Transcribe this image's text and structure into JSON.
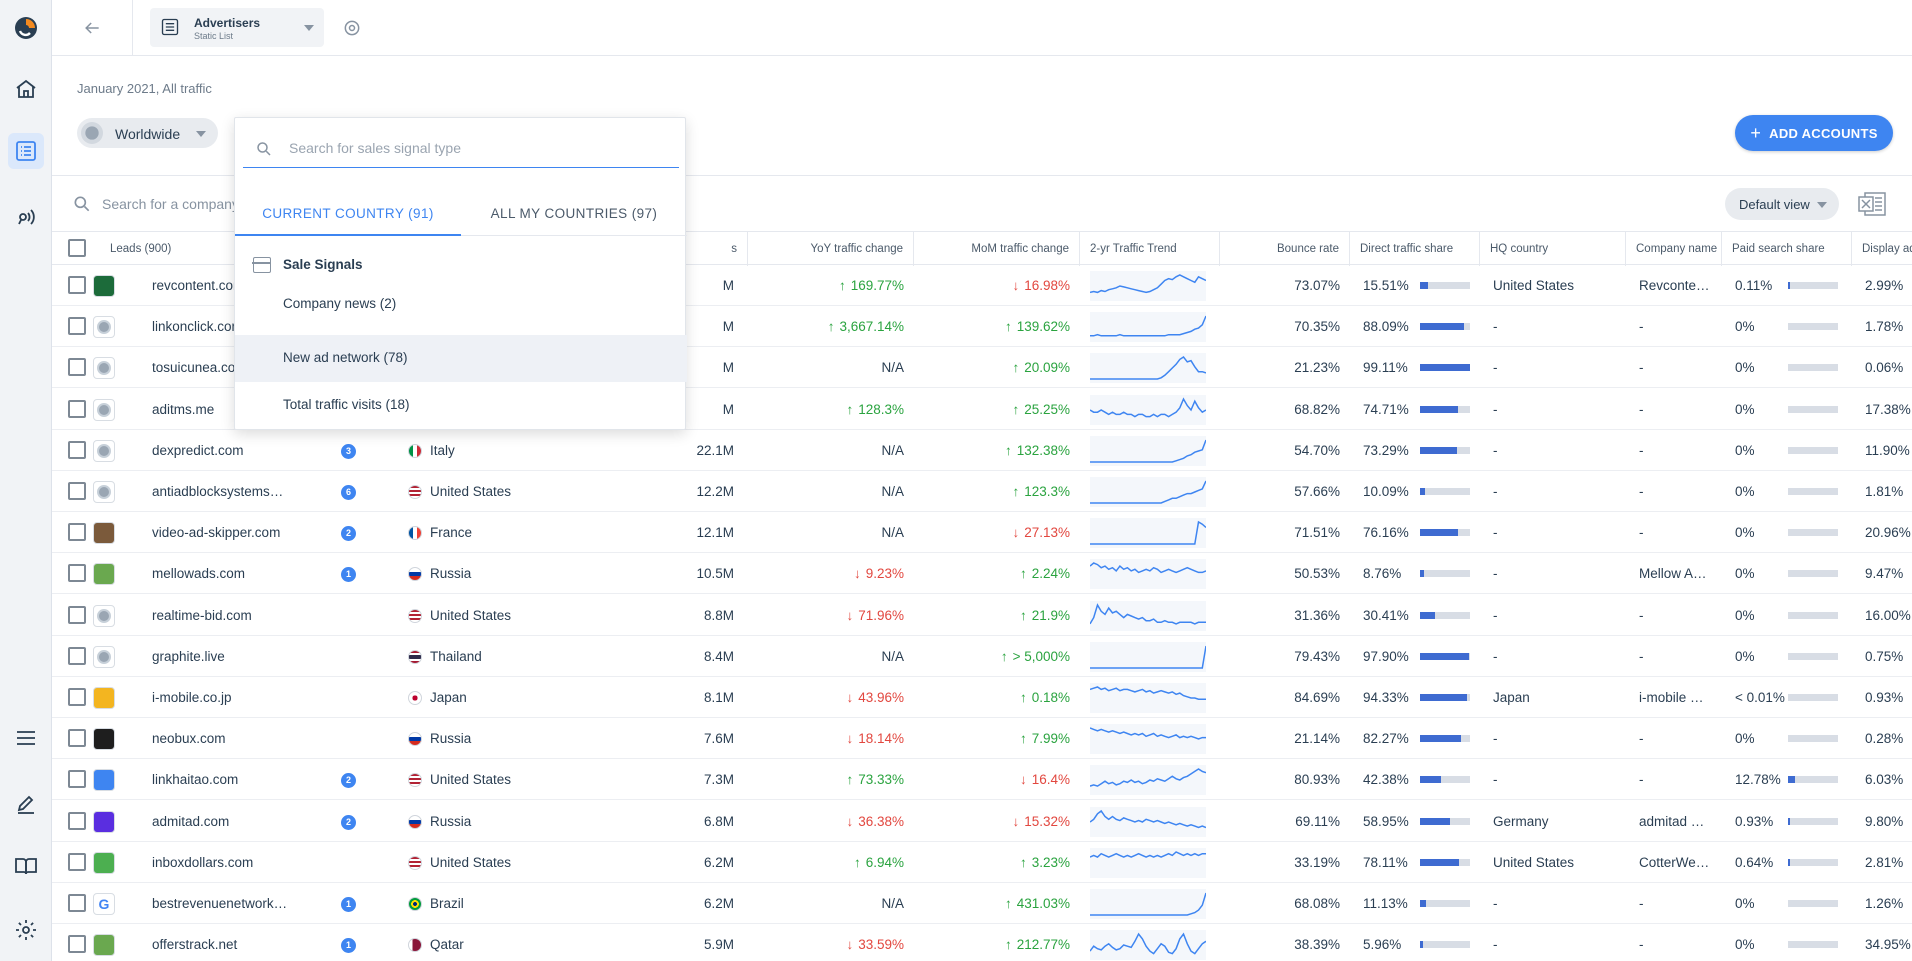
{
  "header": {
    "list_name": "Advertisers",
    "list_type": "Static List"
  },
  "date_range": "January 2021, All traffic",
  "country_filter": "Worldwide",
  "add_accounts_label": "ADD ACCOUNTS",
  "company_search_placeholder": "Search for a company",
  "view_selector": "Default view",
  "dropdown": {
    "search_placeholder": "Search for sales signal type",
    "tabs": [
      {
        "label": "CURRENT COUNTRY (91)",
        "active": true
      },
      {
        "label": "ALL MY COUNTRIES (97)",
        "active": false
      }
    ],
    "group_title": "Sale Signals",
    "items": [
      {
        "label": "Company news (2)"
      },
      {
        "label": "New ad network (78)"
      },
      {
        "label": "Total traffic visits (18)"
      }
    ]
  },
  "table": {
    "columns": {
      "leads": "Leads (900)",
      "visits": "s",
      "yoy": "YoY traffic change",
      "mom": "MoM traffic change",
      "trend": "2-yr Traffic Trend",
      "bounce": "Bounce rate",
      "direct": "Direct traffic share",
      "hq": "HQ country",
      "company": "Company name",
      "paid": "Paid search share",
      "display": "Display ads traffic"
    },
    "rows": [
      {
        "domain": "revcontent.com",
        "badge": "",
        "country": "",
        "visits": "M",
        "yoy": "169.77%",
        "yoy_dir": "up",
        "mom": "16.98%",
        "mom_dir": "down",
        "bounce": "73.07%",
        "direct": "15.51%",
        "direct_frac": 0.155,
        "hq": "United States",
        "company": "Revconte…",
        "paid": "0.11%",
        "paid_frac": 0.001,
        "display": "2.99%",
        "display_frac": 0.03,
        "fav_color": "#1c6b3a",
        "spark": [
          5,
          6,
          5,
          7,
          6,
          8,
          9,
          10,
          12,
          11,
          10,
          9,
          8,
          7,
          6,
          5,
          6,
          8,
          10,
          14,
          18,
          20,
          19,
          22,
          24,
          22,
          20,
          18,
          16,
          22,
          20,
          18
        ]
      },
      {
        "domain": "linkonclick.com",
        "badge": "",
        "country": "",
        "visits": "M",
        "yoy": "3,667.14%",
        "yoy_dir": "up",
        "mom": "139.62%",
        "mom_dir": "up",
        "bounce": "70.35%",
        "direct": "88.09%",
        "direct_frac": 0.88,
        "hq": "-",
        "company": "-",
        "paid": "0%",
        "paid_frac": 0,
        "display": "1.78%",
        "display_frac": 0.018,
        "fav_color": "",
        "spark": [
          2,
          2,
          3,
          2,
          2,
          2,
          2,
          2,
          3,
          2,
          2,
          2,
          2,
          2,
          2,
          2,
          2,
          2,
          2,
          2,
          2,
          3,
          3,
          3,
          3,
          4,
          5,
          6,
          8,
          9,
          12,
          20
        ]
      },
      {
        "domain": "tosuicunea.com",
        "badge": "",
        "country": "",
        "visits": "M",
        "yoy": "N/A",
        "yoy_dir": "",
        "mom": "20.09%",
        "mom_dir": "up",
        "bounce": "21.23%",
        "direct": "99.11%",
        "direct_frac": 0.99,
        "hq": "-",
        "company": "-",
        "paid": "0%",
        "paid_frac": 0,
        "display": "0.06%",
        "display_frac": 0.001,
        "fav_color": "",
        "spark": [
          0,
          0,
          0,
          0,
          0,
          0,
          0,
          0,
          0,
          0,
          0,
          0,
          0,
          0,
          0,
          0,
          0,
          0,
          0,
          1,
          3,
          6,
          9,
          12,
          16,
          18,
          14,
          15,
          10,
          6,
          6,
          5
        ]
      },
      {
        "domain": "aditms.me",
        "badge": "",
        "country": "",
        "visits": "M",
        "yoy": "128.3%",
        "yoy_dir": "up",
        "mom": "25.25%",
        "mom_dir": "up",
        "bounce": "68.82%",
        "direct": "74.71%",
        "direct_frac": 0.75,
        "hq": "-",
        "company": "-",
        "paid": "0%",
        "paid_frac": 0,
        "display": "17.38%",
        "display_frac": 0.17,
        "fav_color": "",
        "spark": [
          5,
          4,
          4,
          5,
          4,
          3,
          4,
          3,
          3,
          4,
          3,
          3,
          2,
          3,
          3,
          2,
          2,
          3,
          2,
          3,
          3,
          2,
          3,
          4,
          6,
          10,
          7,
          5,
          9,
          6,
          4,
          5
        ]
      },
      {
        "domain": "dexpredict.com",
        "badge": "3",
        "country": "Italy",
        "visits": "22.1M",
        "yoy": "N/A",
        "yoy_dir": "",
        "mom": "132.38%",
        "mom_dir": "up",
        "bounce": "54.70%",
        "direct": "73.29%",
        "direct_frac": 0.73,
        "hq": "-",
        "company": "-",
        "paid": "0%",
        "paid_frac": 0,
        "display": "11.90%",
        "display_frac": 0.12,
        "fav_color": "",
        "flag": "it",
        "spark": [
          0,
          0,
          0,
          0,
          0,
          0,
          0,
          0,
          0,
          0,
          0,
          0,
          0,
          0,
          0,
          0,
          0,
          0,
          0,
          0,
          0,
          0,
          0,
          1,
          2,
          3,
          5,
          6,
          8,
          9,
          10,
          18
        ]
      },
      {
        "domain": "antiadblocksystems…",
        "badge": "6",
        "country": "United States",
        "visits": "12.2M",
        "yoy": "N/A",
        "yoy_dir": "",
        "mom": "123.3%",
        "mom_dir": "up",
        "bounce": "57.66%",
        "direct": "10.09%",
        "direct_frac": 0.1,
        "hq": "-",
        "company": "-",
        "paid": "0%",
        "paid_frac": 0,
        "display": "1.81%",
        "display_frac": 0.018,
        "fav_color": "",
        "flag": "us",
        "spark": [
          0,
          0,
          0,
          0,
          0,
          0,
          0,
          0,
          0,
          0,
          0,
          0,
          0,
          0,
          0,
          0,
          0,
          0,
          0,
          0,
          1,
          2,
          3,
          3,
          4,
          5,
          6,
          6,
          7,
          8,
          9,
          14
        ]
      },
      {
        "domain": "video-ad-skipper.com",
        "badge": "2",
        "country": "France",
        "visits": "12.1M",
        "yoy": "N/A",
        "yoy_dir": "",
        "mom": "27.13%",
        "mom_dir": "down",
        "bounce": "71.51%",
        "direct": "76.16%",
        "direct_frac": 0.76,
        "hq": "-",
        "company": "-",
        "paid": "0%",
        "paid_frac": 0,
        "display": "20.96%",
        "display_frac": 0.21,
        "fav_color": "#7b5a3b",
        "flag": "fr",
        "spark": [
          0,
          0,
          0,
          0,
          0,
          0,
          0,
          0,
          0,
          0,
          0,
          0,
          0,
          0,
          0,
          0,
          0,
          0,
          0,
          0,
          0,
          0,
          0,
          0,
          0,
          0,
          0,
          0,
          0,
          20,
          18,
          15
        ]
      },
      {
        "domain": "mellowads.com",
        "badge": "1",
        "country": "Russia",
        "visits": "10.5M",
        "yoy": "9.23%",
        "yoy_dir": "down",
        "mom": "2.24%",
        "mom_dir": "up",
        "bounce": "50.53%",
        "direct": "8.76%",
        "direct_frac": 0.087,
        "hq": "-",
        "company": "Mellow A…",
        "paid": "0%",
        "paid_frac": 0,
        "display": "9.47%",
        "display_frac": 0.09,
        "fav_color": "#6aa84f",
        "flag": "ru",
        "spark": [
          12,
          14,
          13,
          11,
          12,
          10,
          11,
          9,
          12,
          10,
          11,
          9,
          10,
          8,
          9,
          10,
          9,
          11,
          10,
          8,
          9,
          10,
          9,
          8,
          9,
          10,
          11,
          10,
          9,
          8,
          8,
          9
        ]
      },
      {
        "domain": "realtime-bid.com",
        "badge": "",
        "country": "United States",
        "visits": "8.8M",
        "yoy": "71.96%",
        "yoy_dir": "down",
        "mom": "21.9%",
        "mom_dir": "up",
        "bounce": "31.36%",
        "direct": "30.41%",
        "direct_frac": 0.3,
        "hq": "-",
        "company": "-",
        "paid": "0%",
        "paid_frac": 0,
        "display": "16.00%",
        "display_frac": 0.16,
        "fav_color": "",
        "flag": "us",
        "spark": [
          2,
          6,
          14,
          10,
          8,
          12,
          9,
          10,
          8,
          6,
          8,
          7,
          6,
          5,
          6,
          4,
          4,
          5,
          3,
          3,
          4,
          3,
          3,
          2,
          3,
          3,
          3,
          3,
          2,
          3,
          3,
          3
        ]
      },
      {
        "domain": "graphite.live",
        "badge": "",
        "country": "Thailand",
        "visits": "8.4M",
        "yoy": "N/A",
        "yoy_dir": "",
        "mom": "> 5,000%",
        "mom_dir": "up",
        "bounce": "79.43%",
        "direct": "97.90%",
        "direct_frac": 0.98,
        "hq": "-",
        "company": "-",
        "paid": "0%",
        "paid_frac": 0,
        "display": "0.75%",
        "display_frac": 0.008,
        "fav_color": "",
        "flag": "th",
        "spark": [
          0,
          0,
          0,
          0,
          0,
          0,
          0,
          0,
          0,
          0,
          0,
          0,
          0,
          0,
          0,
          0,
          0,
          0,
          0,
          0,
          0,
          0,
          0,
          0,
          0,
          0,
          0,
          0,
          0,
          0,
          0,
          20
        ]
      },
      {
        "domain": "i-mobile.co.jp",
        "badge": "",
        "country": "Japan",
        "visits": "8.1M",
        "yoy": "43.96%",
        "yoy_dir": "down",
        "mom": "0.18%",
        "mom_dir": "up",
        "bounce": "84.69%",
        "direct": "94.33%",
        "direct_frac": 0.94,
        "hq": "Japan",
        "company": "i-mobile …",
        "paid": "< 0.01%",
        "paid_frac": 0,
        "display": "0.93%",
        "display_frac": 0.009,
        "fav_color": "#f3b520",
        "flag": "jp",
        "spark": [
          16,
          17,
          18,
          16,
          17,
          15,
          16,
          17,
          15,
          16,
          16,
          15,
          14,
          15,
          16,
          14,
          15,
          13,
          14,
          15,
          14,
          13,
          14,
          12,
          13,
          11,
          10,
          9,
          9,
          8,
          8,
          8
        ]
      },
      {
        "domain": "neobux.com",
        "badge": "",
        "country": "Russia",
        "visits": "7.6M",
        "yoy": "18.14%",
        "yoy_dir": "down",
        "mom": "7.99%",
        "mom_dir": "up",
        "bounce": "21.14%",
        "direct": "82.27%",
        "direct_frac": 0.82,
        "hq": "-",
        "company": "-",
        "paid": "0%",
        "paid_frac": 0,
        "display": "0.28%",
        "display_frac": 0.003,
        "fav_color": "#1e1e1e",
        "flag": "ru",
        "spark": [
          16,
          15,
          14,
          15,
          14,
          13,
          14,
          13,
          12,
          13,
          12,
          11,
          12,
          11,
          12,
          10,
          11,
          12,
          10,
          11,
          10,
          9,
          10,
          11,
          9,
          10,
          9,
          10,
          9,
          8,
          9,
          9
        ]
      },
      {
        "domain": "linkhaitao.com",
        "badge": "2",
        "country": "United States",
        "visits": "7.3M",
        "yoy": "73.33%",
        "yoy_dir": "up",
        "mom": "16.4%",
        "mom_dir": "down",
        "bounce": "80.93%",
        "direct": "42.38%",
        "direct_frac": 0.42,
        "hq": "-",
        "company": "-",
        "paid": "12.78%",
        "paid_frac": 0.13,
        "display": "6.03%",
        "display_frac": 0.06,
        "fav_color": "#3e85f1",
        "flag": "us",
        "spark": [
          4,
          5,
          4,
          6,
          8,
          6,
          7,
          5,
          6,
          8,
          7,
          9,
          7,
          8,
          6,
          7,
          9,
          8,
          10,
          9,
          8,
          10,
          12,
          10,
          9,
          11,
          12,
          14,
          16,
          18,
          16,
          15
        ]
      },
      {
        "domain": "admitad.com",
        "badge": "2",
        "country": "Russia",
        "visits": "6.8M",
        "yoy": "36.38%",
        "yoy_dir": "down",
        "mom": "15.32%",
        "mom_dir": "down",
        "bounce": "69.11%",
        "direct": "58.95%",
        "direct_frac": 0.59,
        "hq": "Germany",
        "company": "admitad …",
        "paid": "0.93%",
        "paid_frac": 0.009,
        "display": "9.80%",
        "display_frac": 0.1,
        "fav_color": "#5a2ee0",
        "flag": "ru",
        "spark": [
          8,
          10,
          14,
          16,
          12,
          10,
          12,
          10,
          9,
          11,
          10,
          9,
          8,
          9,
          8,
          10,
          9,
          8,
          9,
          8,
          7,
          8,
          7,
          6,
          7,
          6,
          5,
          6,
          5,
          4,
          5,
          4
        ]
      },
      {
        "domain": "inboxdollars.com",
        "badge": "",
        "country": "United States",
        "visits": "6.2M",
        "yoy": "6.94%",
        "yoy_dir": "up",
        "mom": "3.23%",
        "mom_dir": "up",
        "bounce": "33.19%",
        "direct": "78.11%",
        "direct_frac": 0.78,
        "hq": "United States",
        "company": "CotterWe…",
        "paid": "0.64%",
        "paid_frac": 0.006,
        "display": "2.81%",
        "display_frac": 0.028,
        "fav_color": "#4caf50",
        "flag": "us",
        "spark": [
          10,
          11,
          10,
          12,
          11,
          10,
          11,
          12,
          11,
          10,
          11,
          10,
          11,
          12,
          11,
          10,
          11,
          10,
          11,
          10,
          11,
          12,
          11,
          13,
          12,
          11,
          12,
          11,
          12,
          11,
          12,
          12
        ]
      },
      {
        "domain": "bestrevenuenetwork…",
        "badge": "1",
        "country": "Brazil",
        "visits": "6.2M",
        "yoy": "N/A",
        "yoy_dir": "",
        "mom": "431.03%",
        "mom_dir": "up",
        "bounce": "68.08%",
        "direct": "11.13%",
        "direct_frac": 0.11,
        "hq": "-",
        "company": "-",
        "paid": "0%",
        "paid_frac": 0,
        "display": "1.26%",
        "display_frac": 0.013,
        "fav_color": "google",
        "flag": "br",
        "spark": [
          0,
          0,
          0,
          0,
          0,
          0,
          0,
          0,
          0,
          0,
          0,
          0,
          0,
          0,
          0,
          0,
          0,
          0,
          0,
          0,
          0,
          0,
          0,
          0,
          0,
          0,
          0,
          1,
          2,
          4,
          8,
          18
        ]
      },
      {
        "domain": "offerstrack.net",
        "badge": "1",
        "country": "Qatar",
        "visits": "5.9M",
        "yoy": "33.59%",
        "yoy_dir": "down",
        "mom": "212.77%",
        "mom_dir": "up",
        "bounce": "38.39%",
        "direct": "5.96%",
        "direct_frac": 0.06,
        "hq": "-",
        "company": "-",
        "paid": "0%",
        "paid_frac": 0,
        "display": "34.95%",
        "display_frac": 0.35,
        "fav_color": "#6aa84f",
        "flag": "qa",
        "spark": [
          4,
          8,
          6,
          5,
          8,
          10,
          7,
          5,
          6,
          9,
          8,
          7,
          12,
          18,
          14,
          8,
          4,
          2,
          6,
          10,
          8,
          3,
          2,
          6,
          14,
          18,
          10,
          4,
          2,
          6,
          10,
          12
        ]
      }
    ]
  }
}
